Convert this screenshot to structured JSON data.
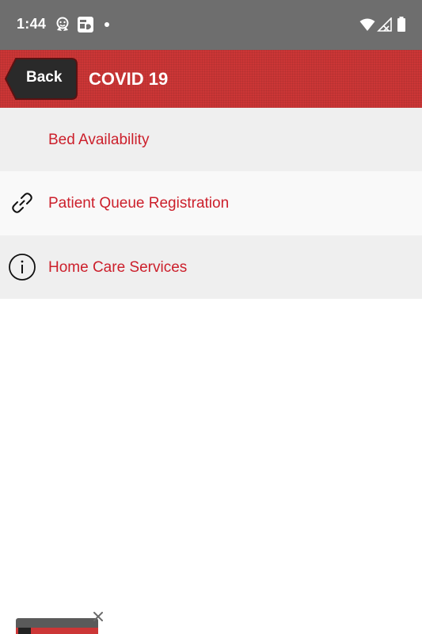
{
  "status_bar": {
    "time": "1:44",
    "icons": [
      "notification-app-icon",
      "notification-badge-icon",
      "notification-dot",
      "wifi-icon",
      "cell-signal-icon",
      "battery-icon"
    ]
  },
  "header": {
    "back_label": "Back",
    "title": "COVID 19",
    "colors": {
      "header_bg": "#cc3636",
      "back_bg": "#2a2a2a"
    }
  },
  "list": {
    "items": [
      {
        "label": "Bed Availability",
        "icon": ""
      },
      {
        "label": "Patient Queue Registration",
        "icon": "link-icon"
      },
      {
        "label": "Home Care Services",
        "icon": "info-icon"
      }
    ],
    "label_color": "#cc1f2b"
  },
  "pip": {
    "close_icon": "close-icon"
  }
}
